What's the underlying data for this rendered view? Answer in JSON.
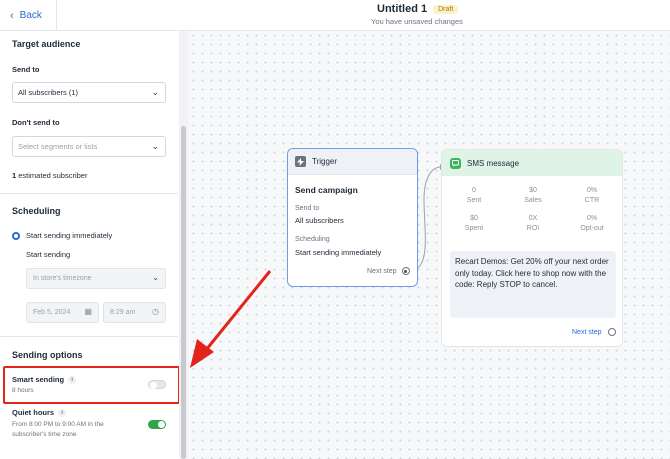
{
  "header": {
    "back_label": "Back",
    "title": "Untitled 1",
    "badge": "Draft",
    "subtitle": "You have unsaved changes"
  },
  "sidebar": {
    "target_audience": {
      "title": "Target audience",
      "send_to_label": "Send to",
      "send_to_value": "All subscribers (1)",
      "dont_send_label": "Don't send to",
      "dont_send_placeholder": "Select segments or lists",
      "estimate_count": "1",
      "estimate_text": "estimated subscriber"
    },
    "scheduling": {
      "title": "Scheduling",
      "option_immediate": "Start sending immediately",
      "option_later": "Start sending",
      "timezone": "In store's timezone",
      "date": "Feb 5, 2024",
      "time": "8:29 am"
    },
    "sending_options": {
      "title": "Sending options",
      "smart_sending_label": "Smart sending",
      "smart_sending_sub": "8 hours",
      "smart_sending_enabled": false,
      "quiet_hours_label": "Quiet hours",
      "quiet_hours_line1": "From 8:00 PM to 9:00 AM in the",
      "quiet_hours_line2": "subscriber's time zone",
      "quiet_hours_enabled": true
    }
  },
  "trigger_node": {
    "header": "Trigger",
    "title": "Send campaign",
    "send_to_label": "Send to",
    "send_to_value": "All subscribers",
    "scheduling_label": "Scheduling",
    "scheduling_value": "Start sending immediately",
    "next_step": "Next step"
  },
  "sms_node": {
    "header": "SMS message",
    "stats": [
      {
        "value": "0",
        "label": "Sent"
      },
      {
        "value": "$0",
        "label": "Sales"
      },
      {
        "value": "0%",
        "label": "CTR"
      },
      {
        "value": "$0",
        "label": "Spent"
      },
      {
        "value": "0X",
        "label": "ROI"
      },
      {
        "value": "0%",
        "label": "Opt-out"
      }
    ],
    "message": "Recart Demos: Get 20% off your next order only today. Click here to shop now with the code: Reply STOP to cancel.",
    "next_step": "Next step"
  },
  "colors": {
    "accent": "#2a6bd6",
    "highlight": "#e3241b",
    "toggle_on": "#2fa34c",
    "sms_header": "#dff3e6"
  }
}
